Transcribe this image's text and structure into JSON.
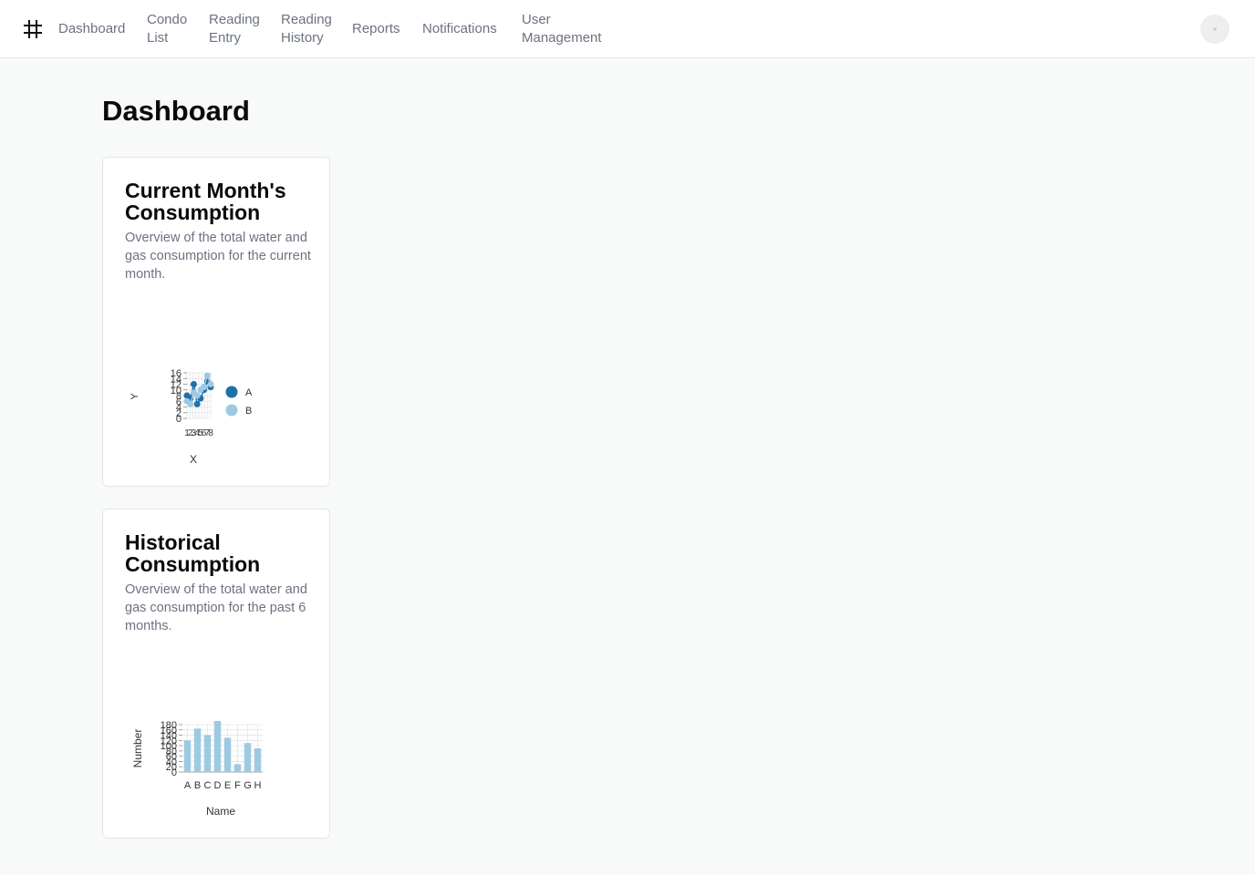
{
  "nav": {
    "items": [
      {
        "line1": "Dashboard",
        "line2": ""
      },
      {
        "line1": "Condo",
        "line2": "List"
      },
      {
        "line1": "Reading",
        "line2": "Entry"
      },
      {
        "line1": "Reading",
        "line2": "History"
      },
      {
        "line1": "Reports",
        "line2": ""
      },
      {
        "line1": "Notifications",
        "line2": ""
      },
      {
        "line1": "User",
        "line2": "Management"
      }
    ]
  },
  "page": {
    "title": "Dashboard"
  },
  "cards": [
    {
      "title": "Current Month's Consumption",
      "description": "Overview of the total water and gas consumption for the current month."
    },
    {
      "title": "Historical Consumption",
      "description": "Overview of the total water and gas consumption for the past 6 months."
    }
  ],
  "chart_data": [
    {
      "type": "scatter",
      "xlabel": "X",
      "ylabel": "Y",
      "ylim": [
        0,
        16
      ],
      "yticks": [
        0,
        2,
        4,
        6,
        8,
        10,
        12,
        14,
        16
      ],
      "colors": [
        "#1f6fa8",
        "#9ecae1"
      ],
      "grid": true,
      "legend": "right",
      "series": [
        {
          "name": "A",
          "x": [
            1,
            2,
            3,
            4,
            5,
            6,
            7,
            8
          ],
          "y": [
            8,
            7,
            12,
            5,
            7,
            10,
            13,
            11
          ]
        },
        {
          "name": "B",
          "x": [
            1,
            2,
            3,
            4,
            5,
            6,
            7,
            8
          ],
          "y": [
            6,
            5,
            9,
            8,
            10,
            11,
            15,
            12
          ]
        }
      ]
    },
    {
      "type": "bar",
      "xlabel": "Name",
      "ylabel": "Number",
      "ylim": [
        0,
        180
      ],
      "yticks": [
        0,
        20,
        40,
        60,
        80,
        100,
        120,
        140,
        160,
        180
      ],
      "colors": [
        "#9ecae1"
      ],
      "grid": true,
      "categories": [
        "A",
        "B",
        "C",
        "D",
        "E",
        "F",
        "G",
        "H"
      ],
      "values": [
        120,
        165,
        140,
        195,
        130,
        30,
        110,
        90
      ]
    }
  ]
}
